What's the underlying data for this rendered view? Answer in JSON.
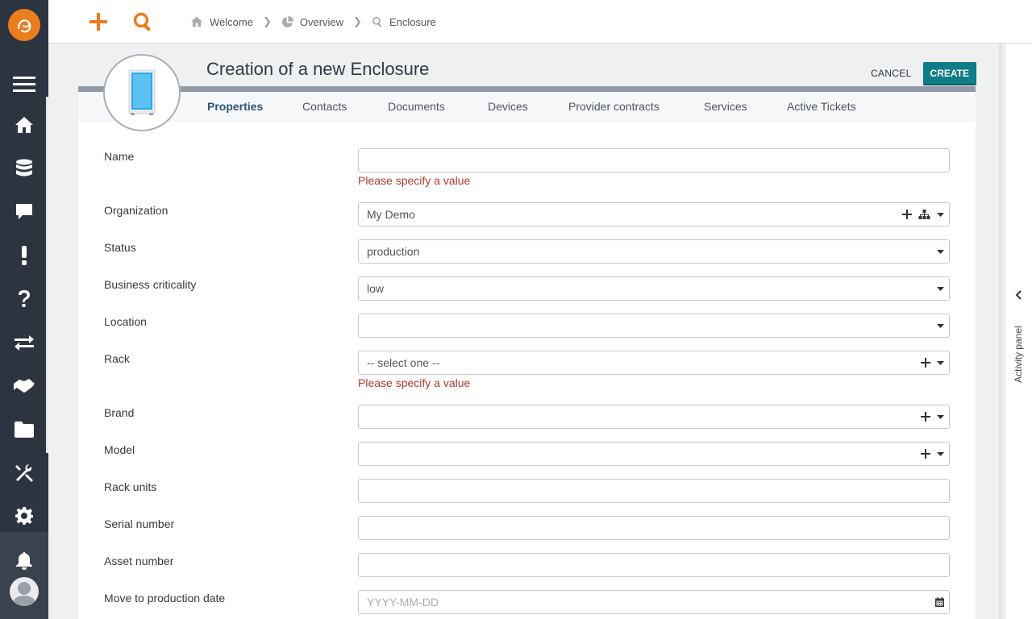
{
  "breadcrumb": {
    "items": [
      {
        "label": "Welcome",
        "icon": "home-icon"
      },
      {
        "label": "Overview",
        "icon": "pie-chart-icon"
      },
      {
        "label": "Enclosure",
        "icon": "search-icon"
      }
    ]
  },
  "topbar": {
    "new_icon": "plus-icon",
    "search_icon": "search-icon"
  },
  "page": {
    "title": "Creation of a new Enclosure",
    "cancel_label": "CANCEL",
    "create_label": "CREATE"
  },
  "tabs": [
    {
      "label": "Properties",
      "active": true
    },
    {
      "label": "Contacts"
    },
    {
      "label": "Documents"
    },
    {
      "label": "Devices"
    },
    {
      "label": "Provider contracts"
    },
    {
      "label": "Services"
    },
    {
      "label": "Active Tickets"
    }
  ],
  "form": {
    "name": {
      "label": "Name",
      "value": "",
      "error": "Please specify a value"
    },
    "organization": {
      "label": "Organization",
      "value": "My Demo"
    },
    "status": {
      "label": "Status",
      "value": "production"
    },
    "business_criticality": {
      "label": "Business criticality",
      "value": "low"
    },
    "location": {
      "label": "Location",
      "value": ""
    },
    "rack": {
      "label": "Rack",
      "value": "-- select one --",
      "error": "Please specify a value"
    },
    "brand": {
      "label": "Brand",
      "value": ""
    },
    "model": {
      "label": "Model",
      "value": ""
    },
    "rack_units": {
      "label": "Rack units",
      "value": ""
    },
    "serial_number": {
      "label": "Serial number",
      "value": ""
    },
    "asset_number": {
      "label": "Asset number",
      "value": ""
    },
    "move_to_production_date": {
      "label": "Move to production date",
      "placeholder": "YYYY-MM-DD"
    }
  },
  "activity_panel": {
    "label": "Activity panel"
  },
  "colors": {
    "accent": "#ea7d1e",
    "primary": "#0f7d88",
    "error": "#b13a32",
    "nav_bg": "#2c353f"
  }
}
